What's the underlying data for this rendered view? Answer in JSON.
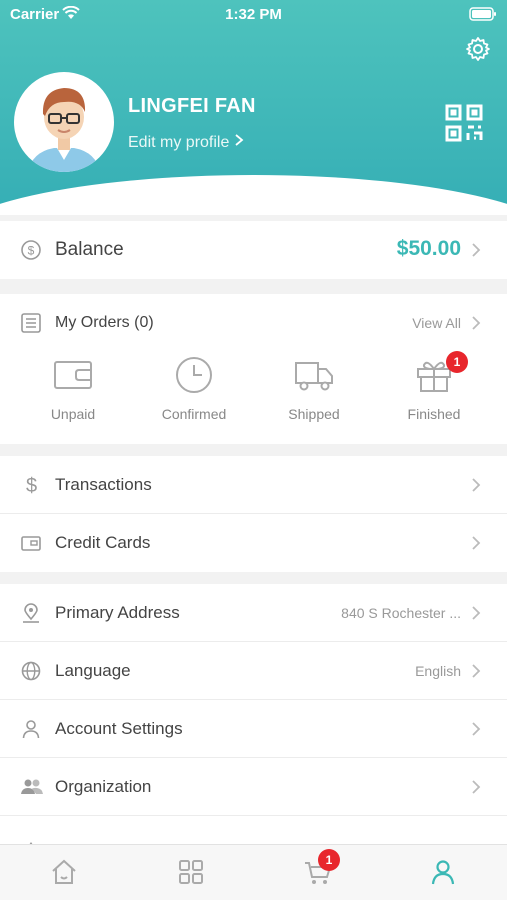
{
  "status_bar": {
    "carrier": "Carrier",
    "time": "1:32 PM"
  },
  "profile": {
    "name": "LINGFEI FAN",
    "edit_label": "Edit my profile"
  },
  "balance": {
    "label": "Balance",
    "amount": "$50.00"
  },
  "orders": {
    "title": "My Orders (0)",
    "view_all": "View All",
    "items": [
      {
        "label": "Unpaid",
        "icon": "wallet-icon"
      },
      {
        "label": "Confirmed",
        "icon": "clock-icon"
      },
      {
        "label": "Shipped",
        "icon": "truck-icon"
      },
      {
        "label": "Finished",
        "icon": "gift-icon",
        "badge": "1"
      }
    ]
  },
  "menu": {
    "transactions": "Transactions",
    "credit_cards": "Credit Cards",
    "primary_address": "Primary Address",
    "primary_address_value": "840 S Rochester ...",
    "language": "Language",
    "language_value": "English",
    "account_settings": "Account Settings",
    "organization": "Organization"
  },
  "tabbar": {
    "cart_badge": "1",
    "active_tab": "profile"
  },
  "colors": {
    "accent": "#3bb8b5",
    "header_top": "#4ec3bd",
    "badge": "#e8262c"
  }
}
